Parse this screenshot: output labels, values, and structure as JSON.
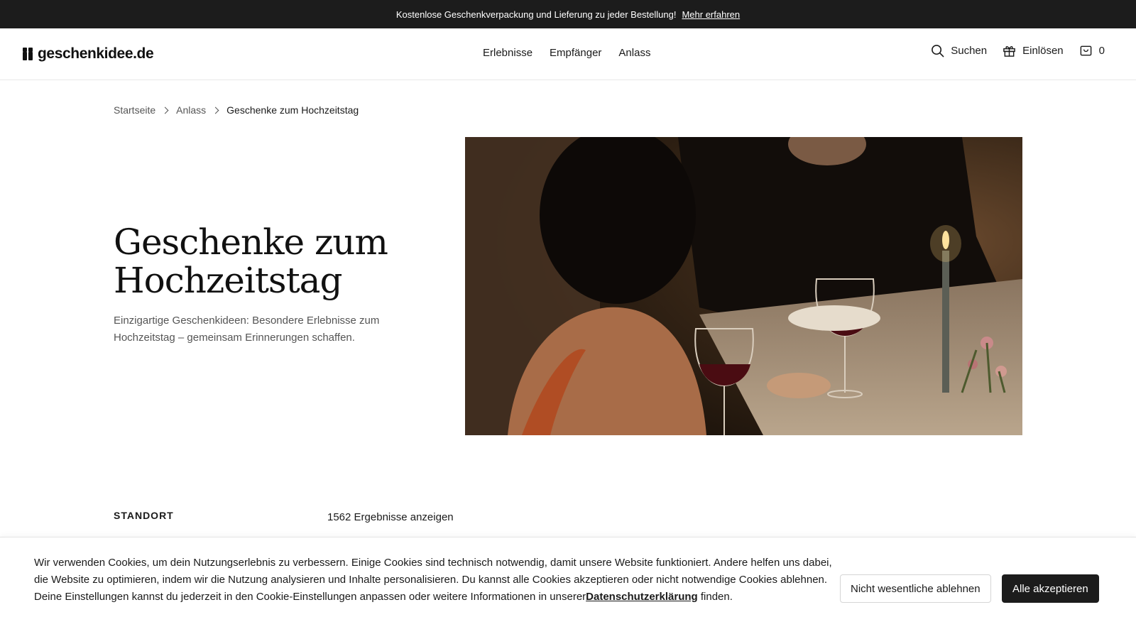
{
  "promo": {
    "text": "Kostenlose Geschenkverpackung und Lieferung zu jeder Bestellung!",
    "link": "Mehr erfahren"
  },
  "header": {
    "logo": "geschenkidee.de",
    "nav": [
      "Erlebnisse",
      "Empfänger",
      "Anlass"
    ],
    "search_label": "Suchen",
    "redeem_label": "Einlösen",
    "cart_count": "0"
  },
  "breadcrumb": {
    "home": "Startseite",
    "parent": "Anlass",
    "current": "Geschenke zum Hochzeitstag"
  },
  "hero": {
    "title": "Geschenke zum Hochzeitstag",
    "description": "Einzigartige Geschenkideen: Besondere Erlebnisse zum Hochzeitstag – gemeinsam Erinnerungen schaffen."
  },
  "filters": {
    "location_label": "STANDORT",
    "results": "1562 Ergebnisse anzeigen"
  },
  "cookie": {
    "text": "Wir verwenden Cookies, um dein Nutzungserlebnis zu verbessern. Einige Cookies sind technisch notwendig, damit unsere Website funktioniert. Andere helfen uns dabei, die Website zu optimieren, indem wir die Nutzung analysieren und Inhalte personalisieren. Du kannst alle Cookies akzeptieren oder nicht notwendige Cookies ablehnen. Deine Einstellungen kannst du jederzeit in den Cookie-Einstellungen anpassen oder weitere Informationen in unserer",
    "privacy_link": "Datenschutzerklärung",
    "text_end": "finden.",
    "decline": "Nicht wesentliche ablehnen",
    "accept": "Alle akzeptieren"
  },
  "colors": {
    "promo_bg": "#1c1c1c",
    "accept_bg": "#1c1c1c",
    "text": "#1a1a1a",
    "muted": "#555555"
  },
  "icons": [
    "search-icon",
    "gift-icon",
    "cart-icon",
    "chevron-right-icon"
  ]
}
